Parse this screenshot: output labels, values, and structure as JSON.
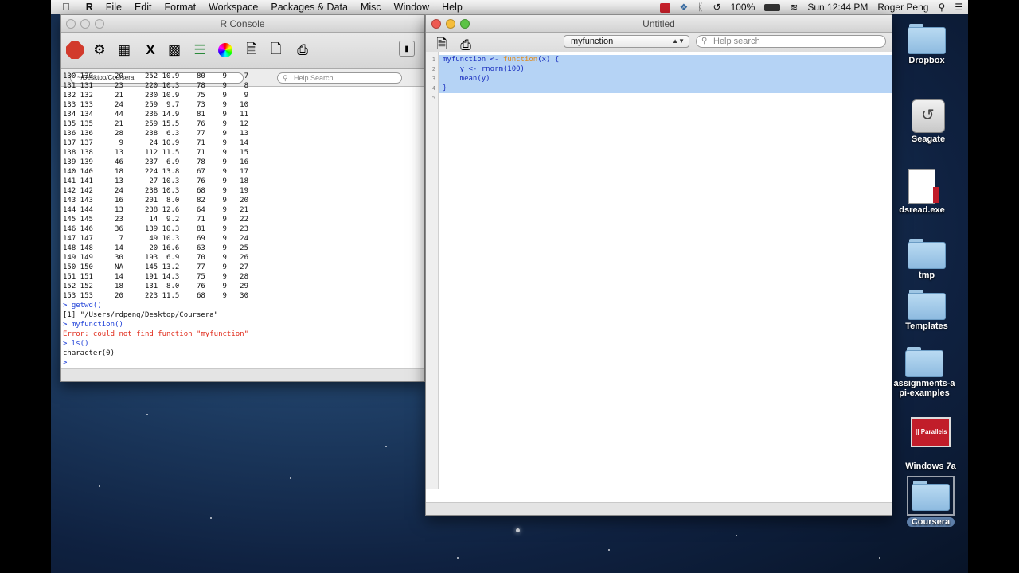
{
  "menubar": {
    "app": "R",
    "items": [
      "File",
      "Edit",
      "Format",
      "Workspace",
      "Packages & Data",
      "Misc",
      "Window",
      "Help"
    ],
    "battery": "100%",
    "clock": "Sun 12:44 PM",
    "user": "Roger Peng"
  },
  "console": {
    "title": "R Console",
    "path": "~/Desktop/Coursera",
    "search_placeholder": "Help Search",
    "data_rows": [
      [
        "130",
        "130",
        "20",
        "252",
        "10.9",
        "80",
        "9",
        "7"
      ],
      [
        "131",
        "131",
        "23",
        "220",
        "10.3",
        "78",
        "9",
        "8"
      ],
      [
        "132",
        "132",
        "21",
        "230",
        "10.9",
        "75",
        "9",
        "9"
      ],
      [
        "133",
        "133",
        "24",
        "259",
        "9.7",
        "73",
        "9",
        "10"
      ],
      [
        "134",
        "134",
        "44",
        "236",
        "14.9",
        "81",
        "9",
        "11"
      ],
      [
        "135",
        "135",
        "21",
        "259",
        "15.5",
        "76",
        "9",
        "12"
      ],
      [
        "136",
        "136",
        "28",
        "238",
        "6.3",
        "77",
        "9",
        "13"
      ],
      [
        "137",
        "137",
        "9",
        "24",
        "10.9",
        "71",
        "9",
        "14"
      ],
      [
        "138",
        "138",
        "13",
        "112",
        "11.5",
        "71",
        "9",
        "15"
      ],
      [
        "139",
        "139",
        "46",
        "237",
        "6.9",
        "78",
        "9",
        "16"
      ],
      [
        "140",
        "140",
        "18",
        "224",
        "13.8",
        "67",
        "9",
        "17"
      ],
      [
        "141",
        "141",
        "13",
        "27",
        "10.3",
        "76",
        "9",
        "18"
      ],
      [
        "142",
        "142",
        "24",
        "238",
        "10.3",
        "68",
        "9",
        "19"
      ],
      [
        "143",
        "143",
        "16",
        "201",
        "8.0",
        "82",
        "9",
        "20"
      ],
      [
        "144",
        "144",
        "13",
        "238",
        "12.6",
        "64",
        "9",
        "21"
      ],
      [
        "145",
        "145",
        "23",
        "14",
        "9.2",
        "71",
        "9",
        "22"
      ],
      [
        "146",
        "146",
        "36",
        "139",
        "10.3",
        "81",
        "9",
        "23"
      ],
      [
        "147",
        "147",
        "7",
        "49",
        "10.3",
        "69",
        "9",
        "24"
      ],
      [
        "148",
        "148",
        "14",
        "20",
        "16.6",
        "63",
        "9",
        "25"
      ],
      [
        "149",
        "149",
        "30",
        "193",
        "6.9",
        "70",
        "9",
        "26"
      ],
      [
        "150",
        "150",
        "NA",
        "145",
        "13.2",
        "77",
        "9",
        "27"
      ],
      [
        "151",
        "151",
        "14",
        "191",
        "14.3",
        "75",
        "9",
        "28"
      ],
      [
        "152",
        "152",
        "18",
        "131",
        "8.0",
        "76",
        "9",
        "29"
      ],
      [
        "153",
        "153",
        "20",
        "223",
        "11.5",
        "68",
        "9",
        "30"
      ]
    ],
    "session": [
      {
        "kind": "input",
        "text": "> getwd()"
      },
      {
        "kind": "output",
        "text": "[1] \"/Users/rdpeng/Desktop/Coursera\""
      },
      {
        "kind": "input",
        "text": "> myfunction()"
      },
      {
        "kind": "error",
        "text": "Error: could not find function \"myfunction\""
      },
      {
        "kind": "input",
        "text": "> ls()"
      },
      {
        "kind": "output",
        "text": "character(0)"
      },
      {
        "kind": "input",
        "text": ">"
      }
    ]
  },
  "editor": {
    "title": "Untitled",
    "function_selector": "myfunction",
    "search_placeholder": "Help search",
    "line_numbers": [
      "1",
      "2",
      "3",
      "4",
      "5"
    ],
    "code": [
      {
        "pre": "myfunction <- ",
        "kw": "function",
        "post": "(x) {"
      },
      {
        "pre": "    y <- rnorm(100)",
        "kw": "",
        "post": ""
      },
      {
        "pre": "    mean(y)",
        "kw": "",
        "post": ""
      },
      {
        "pre": "}",
        "kw": "",
        "post": ""
      },
      {
        "pre": "",
        "kw": "",
        "post": ""
      }
    ]
  },
  "desktop": {
    "icons": [
      {
        "label": "Dropbox",
        "kind": "folder"
      },
      {
        "label": "Seagate",
        "kind": "drive"
      },
      {
        "label": "dsread.exe",
        "kind": "doc"
      },
      {
        "label": "tmp",
        "kind": "folder"
      },
      {
        "label": "Templates",
        "kind": "folder"
      },
      {
        "label": "assignments-api-examples",
        "kind": "folder"
      },
      {
        "label": "Windows 7a",
        "kind": "monitor"
      },
      {
        "label": "Coursera",
        "kind": "folder"
      }
    ]
  },
  "colors": {
    "selection": "#b5d3f5",
    "code_text": "#1a2fbf",
    "keyword": "#e08a1a",
    "console_input": "#1d3fd8",
    "console_error": "#e02a1a"
  }
}
